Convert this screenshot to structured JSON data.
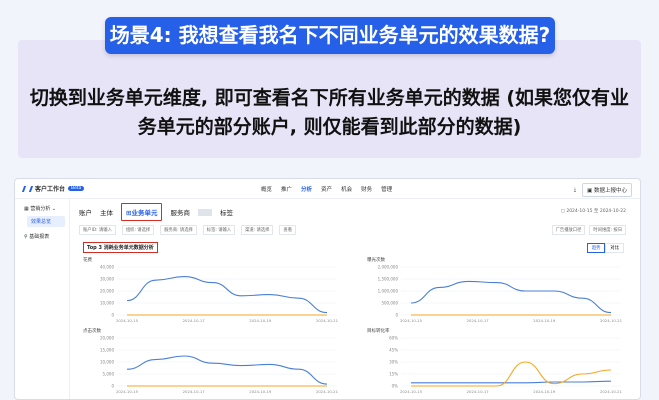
{
  "banner": {
    "title": "场景4: 我想查看我名下不同业务单元的效果数据?"
  },
  "intro": {
    "line1": "切换到业务单元维度, 即可查看名下所有业务单元的数据 (如果您仅有业",
    "line2": "务单元的部分账户, 则仅能看到此部分的数据)"
  },
  "app": {
    "name": "客户工作台",
    "badge": "Beta",
    "nav": [
      "概览",
      "推广",
      "分析",
      "资产",
      "机会",
      "财务",
      "管理"
    ],
    "nav_active": "分析",
    "report_button": "数据上报中心",
    "sidebar": {
      "group": "营销分析",
      "sub": "效果总览",
      "item2": "基础报表"
    },
    "tabs": [
      "账户",
      "主体",
      "业务单元",
      "服务商",
      "",
      "标签"
    ],
    "date_range": "2024-10-15 至 2024-10-22",
    "filters": [
      "账户ID: 请输入",
      "组织: 请选择",
      "服务商: 请选择",
      "标签: 请输入",
      "渠道: 请选择",
      "查看"
    ],
    "right_filters": [
      "广告播放口径",
      "时间维度: 按日"
    ],
    "section_title": "Top 3 消耗业务单元数据分析",
    "toggle": [
      "趋势",
      "对比"
    ],
    "toggle_active": "趋势"
  },
  "colors": {
    "primary": "#2660e8",
    "series1": "#4a7fd8",
    "series2": "#f5a623",
    "highlight": "#d12d24"
  },
  "chart_data": [
    {
      "type": "line",
      "title": "花费",
      "x": [
        "2024-10-15",
        "2024-10-17",
        "2024-10-19",
        "2024-10-21"
      ],
      "yticks": [
        "40,000",
        "30,000",
        "20,000",
        "10,000",
        "0"
      ],
      "ylim": [
        0,
        40000
      ],
      "series": [
        {
          "values": [
            12000,
            29000,
            32000,
            27000,
            16000,
            17000,
            14000,
            2000
          ]
        },
        {
          "values": [
            0,
            0,
            0,
            0,
            0,
            0,
            0,
            0
          ]
        }
      ]
    },
    {
      "type": "line",
      "title": "曝光次数",
      "x": [
        "2024-10-15",
        "2024-10-17",
        "2024-10-19",
        "2024-10-21"
      ],
      "yticks": [
        "2,000,000",
        "1,500,000",
        "1,000,000",
        "500,000",
        "0"
      ],
      "ylim": [
        0,
        2000000
      ],
      "series": [
        {
          "values": [
            500000,
            1150000,
            1400000,
            1350000,
            1000000,
            1000000,
            700000,
            100000
          ]
        },
        {
          "values": [
            0,
            0,
            0,
            0,
            0,
            0,
            0,
            0
          ]
        }
      ]
    },
    {
      "type": "line",
      "title": "点击次数",
      "x": [
        "2024-10-15",
        "2024-10-17",
        "2024-10-19",
        "2024-10-21"
      ],
      "yticks": [
        "20,000",
        "15,000",
        "10,000",
        "5,000",
        "0"
      ],
      "ylim": [
        0,
        20000
      ],
      "series": [
        {
          "values": [
            7000,
            11000,
            12500,
            9500,
            8500,
            9000,
            7000,
            800
          ]
        },
        {
          "values": [
            0,
            0,
            0,
            0,
            0,
            0,
            0,
            0
          ]
        }
      ]
    },
    {
      "type": "line",
      "title": "目标转化率",
      "x": [
        "2024-10-15",
        "2024-10-17",
        "2024-10-19",
        "2024-10-21"
      ],
      "yticks": [
        "60%",
        "45%",
        "30%",
        "15%",
        "0%"
      ],
      "ylim": [
        0,
        60
      ],
      "series": [
        {
          "values": [
            4,
            4,
            4,
            4,
            4,
            5,
            5,
            6
          ]
        },
        {
          "values": [
            0,
            0,
            0,
            0,
            30,
            3,
            15,
            20
          ]
        }
      ]
    }
  ]
}
